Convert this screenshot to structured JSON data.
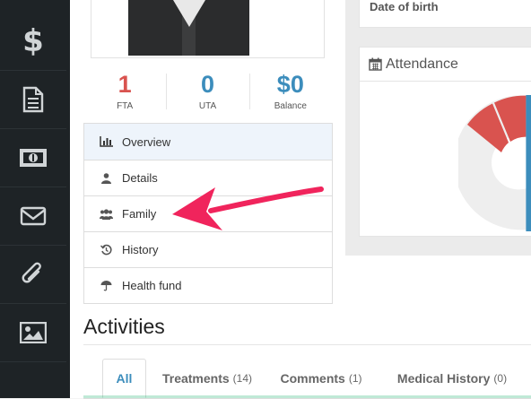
{
  "sidebar": {
    "items": [
      {
        "icon": "dollar-icon",
        "glyph": "$"
      },
      {
        "icon": "document-icon"
      },
      {
        "icon": "money-icon"
      },
      {
        "icon": "envelope-icon"
      },
      {
        "icon": "paperclip-icon"
      },
      {
        "icon": "image-icon"
      }
    ]
  },
  "stats": [
    {
      "value": "1",
      "label": "FTA",
      "color": "#d9534f"
    },
    {
      "value": "0",
      "label": "UTA",
      "color": "#3c8dbc"
    },
    {
      "value": "$0",
      "label": "Balance",
      "color": "#3c8dbc"
    }
  ],
  "menu": {
    "items": [
      {
        "label": "Overview",
        "icon": "bar-chart-icon"
      },
      {
        "label": "Details",
        "icon": "user-icon"
      },
      {
        "label": "Family",
        "icon": "users-icon"
      },
      {
        "label": "History",
        "icon": "history-icon"
      },
      {
        "label": "Health fund",
        "icon": "umbrella-icon"
      }
    ]
  },
  "profile": {
    "dob_label": "Date of birth"
  },
  "attendance": {
    "title": "Attendance",
    "icon": "calendar-icon",
    "colors": {
      "red": "#d9534f",
      "grey": "#eeeeee",
      "blue": "#3c8dbc"
    }
  },
  "activities": {
    "title": "Activities",
    "tabs": [
      {
        "label": "All",
        "count": ""
      },
      {
        "label": "Treatments",
        "count": "(14)"
      },
      {
        "label": "Comments",
        "count": "(1)"
      },
      {
        "label": "Medical History",
        "count": "(0)"
      }
    ],
    "active_tab": "All"
  },
  "annotation": {
    "arrow_color": "#f0245c"
  }
}
